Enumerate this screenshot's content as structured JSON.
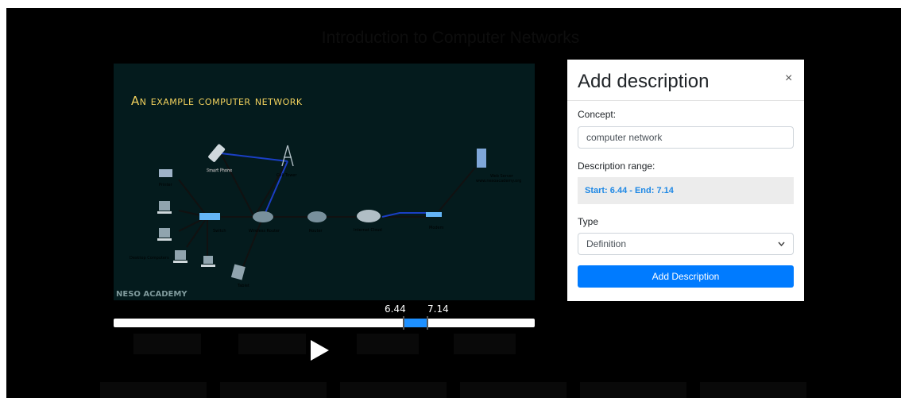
{
  "page": {
    "title": "Introduction to Computer Networks"
  },
  "video": {
    "slide_title": "An example computer network",
    "watermark": "NESO ACADEMY",
    "diagram_labels": {
      "smart_phone": "Smart Phone",
      "cell_tower": "Cell Tower",
      "printer": "Printer",
      "switch": "Switch",
      "wireless_router": "Wireless Router",
      "router": "Router",
      "internet_cloud": "Internet Cloud",
      "modem": "Modem",
      "web_server": "Web Server",
      "web_server_url": "www.nesoacademy.org",
      "desktop_computers": "Desktop Computers",
      "tablet": "Tablet"
    }
  },
  "timeline": {
    "start_label": "6.44",
    "end_label": "7.14"
  },
  "modal": {
    "title": "Add description",
    "close_label": "×",
    "concept_label": "Concept:",
    "concept_value": "computer network",
    "range_label": "Description range:",
    "range_text": "Start: 6.44 - End: 7.14",
    "type_label": "Type",
    "type_selected": "Definition",
    "submit_label": "Add Description"
  },
  "colors": {
    "accent": "#007bff",
    "range_text": "#1e88e5",
    "video_bg": "#041b1d",
    "slide_title": "#f4d35e"
  }
}
